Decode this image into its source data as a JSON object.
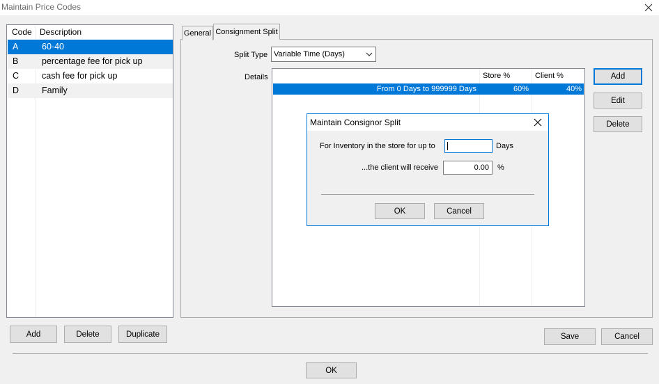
{
  "window": {
    "title": "Maintain Price Codes"
  },
  "price_codes": {
    "headers": {
      "code": "Code",
      "description": "Description"
    },
    "rows": [
      {
        "code": "A",
        "description": "60-40",
        "selected": true
      },
      {
        "code": "B",
        "description": "percentage fee for pick up",
        "selected": false
      },
      {
        "code": "C",
        "description": "cash fee for pick up",
        "selected": false
      },
      {
        "code": "D",
        "description": "Family",
        "selected": false
      }
    ],
    "buttons": {
      "add": "Add",
      "delete": "Delete",
      "duplicate": "Duplicate"
    }
  },
  "tabs": {
    "general": "General",
    "consignment_split": "Consignment Split"
  },
  "consignment": {
    "split_type_label": "Split Type",
    "split_type_value": "Variable Time (Days)",
    "details_label": "Details",
    "grid": {
      "headers": {
        "range": "",
        "store": "Store %",
        "client": "Client %"
      },
      "rows": [
        {
          "range": "From 0 Days to 999999 Days",
          "store": "60%",
          "client": "40%"
        }
      ]
    },
    "buttons": {
      "add": "Add",
      "edit": "Edit",
      "delete": "Delete"
    }
  },
  "dialog": {
    "title": "Maintain Consignor Split",
    "inventory_label": "For Inventory in the store for up to",
    "days_value": "",
    "days_unit": "Days",
    "client_label": "...the client will receive",
    "client_value": "0.00",
    "percent_unit": "%",
    "ok": "OK",
    "cancel": "Cancel"
  },
  "footer": {
    "save": "Save",
    "cancel": "Cancel",
    "ok": "OK"
  },
  "colors": {
    "selection": "#0078d7",
    "background": "#f0f0f0"
  }
}
